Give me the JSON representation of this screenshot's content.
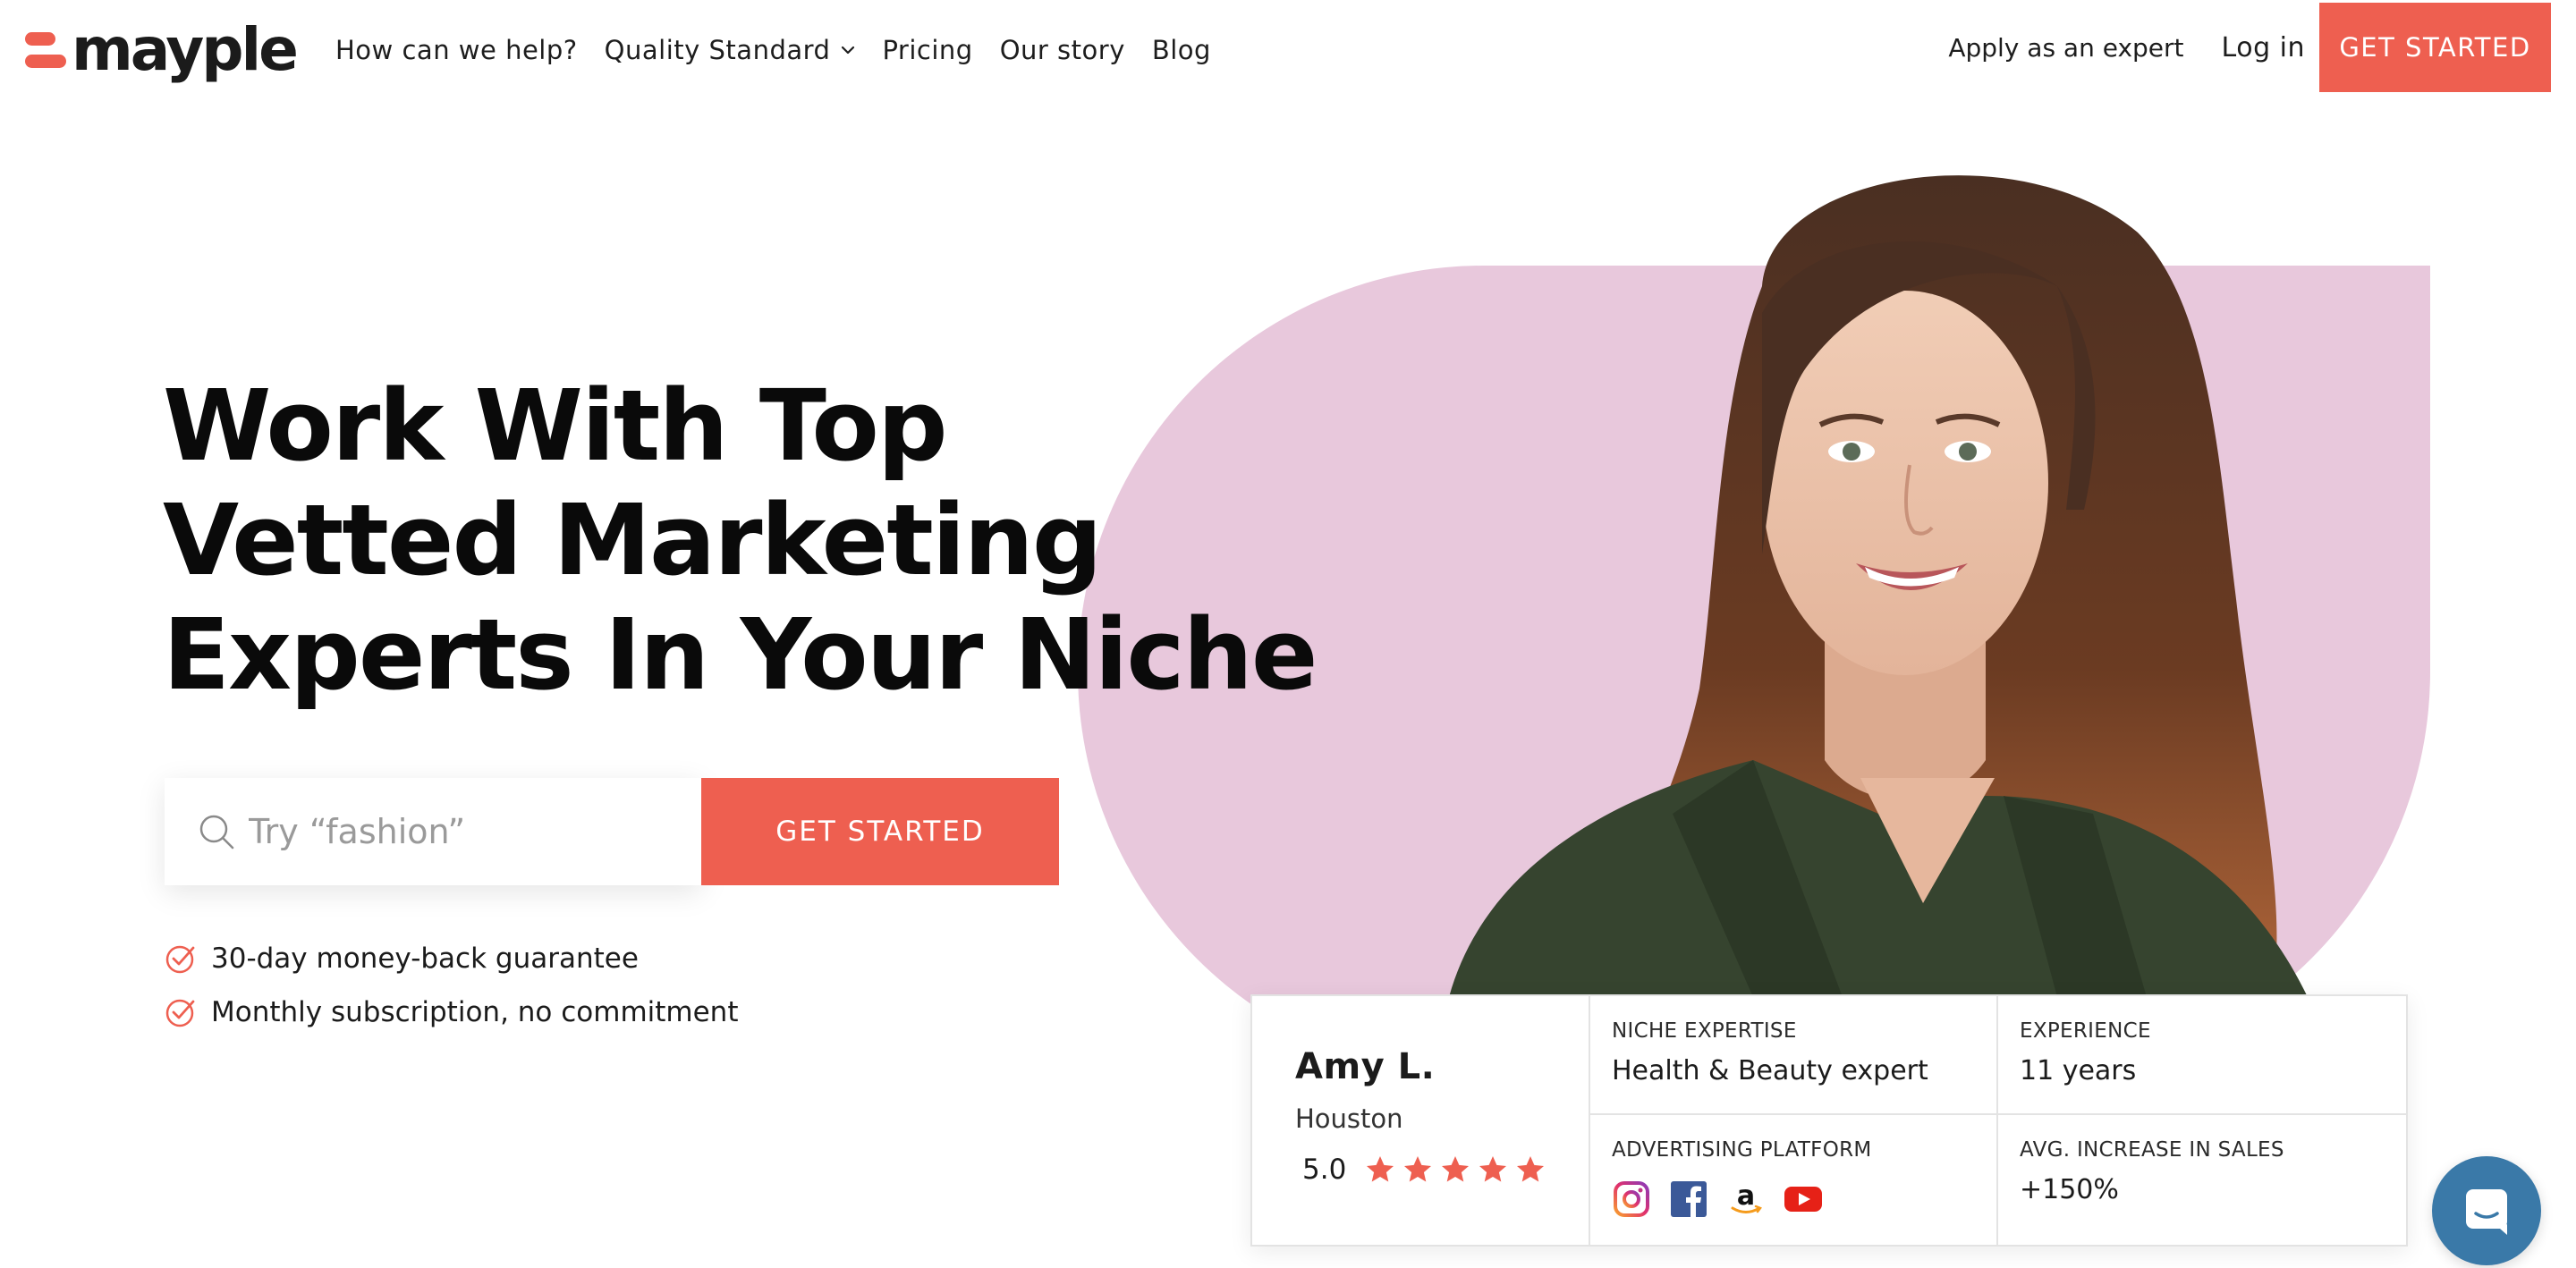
{
  "brand": {
    "name": "mayple",
    "accent": "#ee5f50",
    "pink": "#e8c8dc"
  },
  "nav": {
    "items": [
      "How can we help?",
      "Quality Standard",
      "Pricing",
      "Our story",
      "Blog"
    ],
    "apply": "Apply as an expert",
    "login": "Log in",
    "cta": "GET STARTED"
  },
  "hero": {
    "headline": [
      "Work With Top",
      "Vetted Marketing",
      "Experts In Your Niche"
    ],
    "search_placeholder": "Try “fashion”",
    "search_icon": "search-icon",
    "cta": "GET STARTED",
    "benefits": [
      "30-day money-back guarantee",
      "Monthly subscription, no commitment"
    ]
  },
  "expert": {
    "name": "Amy L.",
    "city": "Houston",
    "rating": "5.0",
    "stars": 5,
    "niche_label": "NICHE EXPERTISE",
    "niche_value": "Health & Beauty expert",
    "experience_label": "EXPERIENCE",
    "experience_value": "11 years",
    "platform_label": "ADVERTISING PLATFORM",
    "platforms": [
      "instagram-icon",
      "facebook-icon",
      "amazon-icon",
      "youtube-icon"
    ],
    "sales_label": "AVG. INCREASE IN SALES",
    "sales_value": "+150%"
  },
  "chat": {
    "icon": "chat-icon",
    "color": "#3a79a8"
  }
}
